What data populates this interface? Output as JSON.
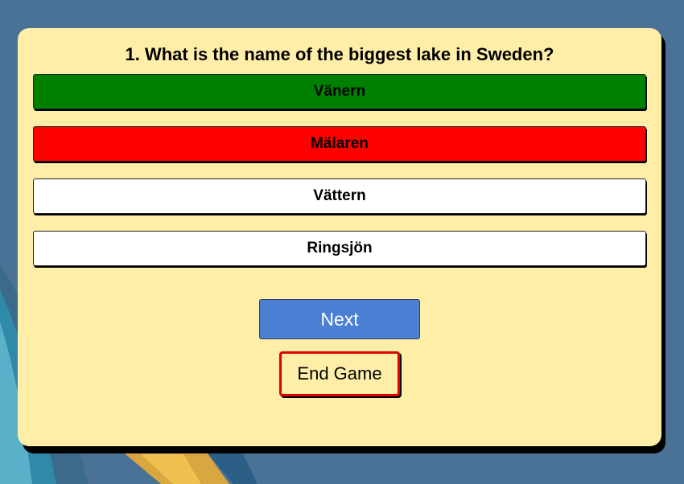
{
  "quiz": {
    "question": "1. What is the name of the biggest lake in Sweden?",
    "answers": [
      {
        "label": "Vänern",
        "state": "correct"
      },
      {
        "label": "Mälaren",
        "state": "wrong"
      },
      {
        "label": "Vättern",
        "state": "neutral"
      },
      {
        "label": "Ringsjön",
        "state": "neutral"
      }
    ],
    "next_label": "Next",
    "end_label": "End Game"
  },
  "colors": {
    "background": "#4a7297",
    "card": "#ffeea8",
    "correct": "#008000",
    "wrong": "#ff0000",
    "next_button": "#4a7fd4",
    "end_border": "#e00000"
  }
}
